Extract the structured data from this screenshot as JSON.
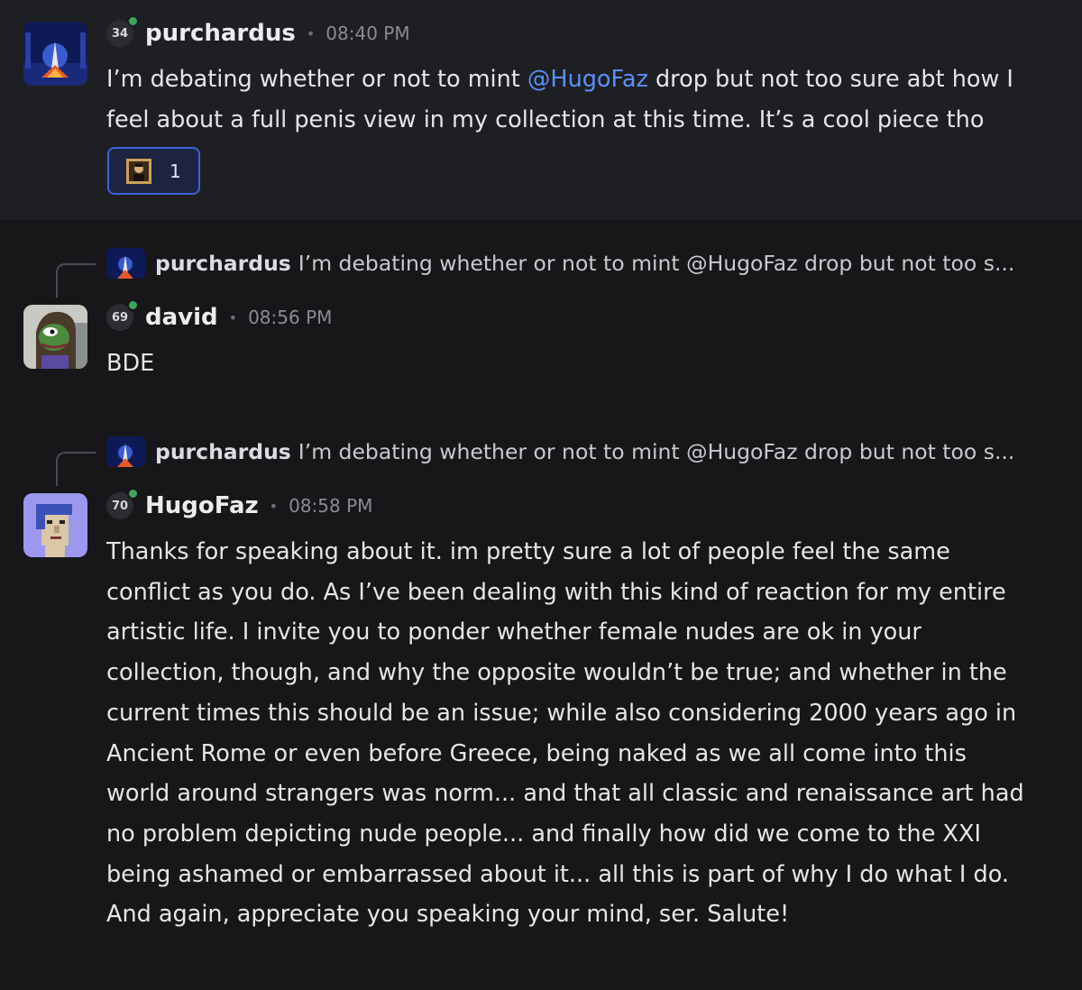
{
  "messages": [
    {
      "level": "34",
      "username": "purchardus",
      "time": "08:40 PM",
      "text_before": "I’m debating whether or not to mint ",
      "mention": "@HugoFaz",
      "text_after": " drop but not too sure abt how I feel about a full penis view in my collection at this time. It’s a cool piece tho",
      "reaction": {
        "icon": "portrait-emoji-icon",
        "count": "1"
      }
    },
    {
      "reply": {
        "username": "purchardus",
        "text": "I’m debating whether or not to mint @HugoFaz drop but not too s..."
      },
      "level": "69",
      "username": "david",
      "time": "08:56 PM",
      "text": "BDE"
    },
    {
      "reply": {
        "username": "purchardus",
        "text": "I’m debating whether or not to mint @HugoFaz drop but not too s..."
      },
      "level": "70",
      "username": "HugoFaz",
      "time": "08:58 PM",
      "lines": [
        "Thanks for speaking about it. im pretty sure a lot of people feel the same",
        "conflict as you do. As I’ve been dealing with this kind of reaction for my entire",
        "artistic life. I invite you to ponder whether female nudes are ok in your",
        "collection, though, and why the opposite wouldn’t be true; and whether in the",
        "current times this should be an issue; while also considering 2000 years ago in",
        "Ancient Rome or even before Greece, being naked as we all come into this",
        "world around strangers was norm... and that all classic and renaissance art had",
        "no problem depicting nude people... and finally how did we come to the XXI",
        "being ashamed or embarrassed about it... all this is part of why I do what I do.",
        "And again, appreciate you speaking your mind, ser. Salute!"
      ]
    }
  ],
  "colors": {
    "background": "#17171a",
    "highlight": "#1e1f23",
    "mention": "#5b8ff9",
    "online": "#3ba55d",
    "reaction_border": "#3b64d8"
  }
}
